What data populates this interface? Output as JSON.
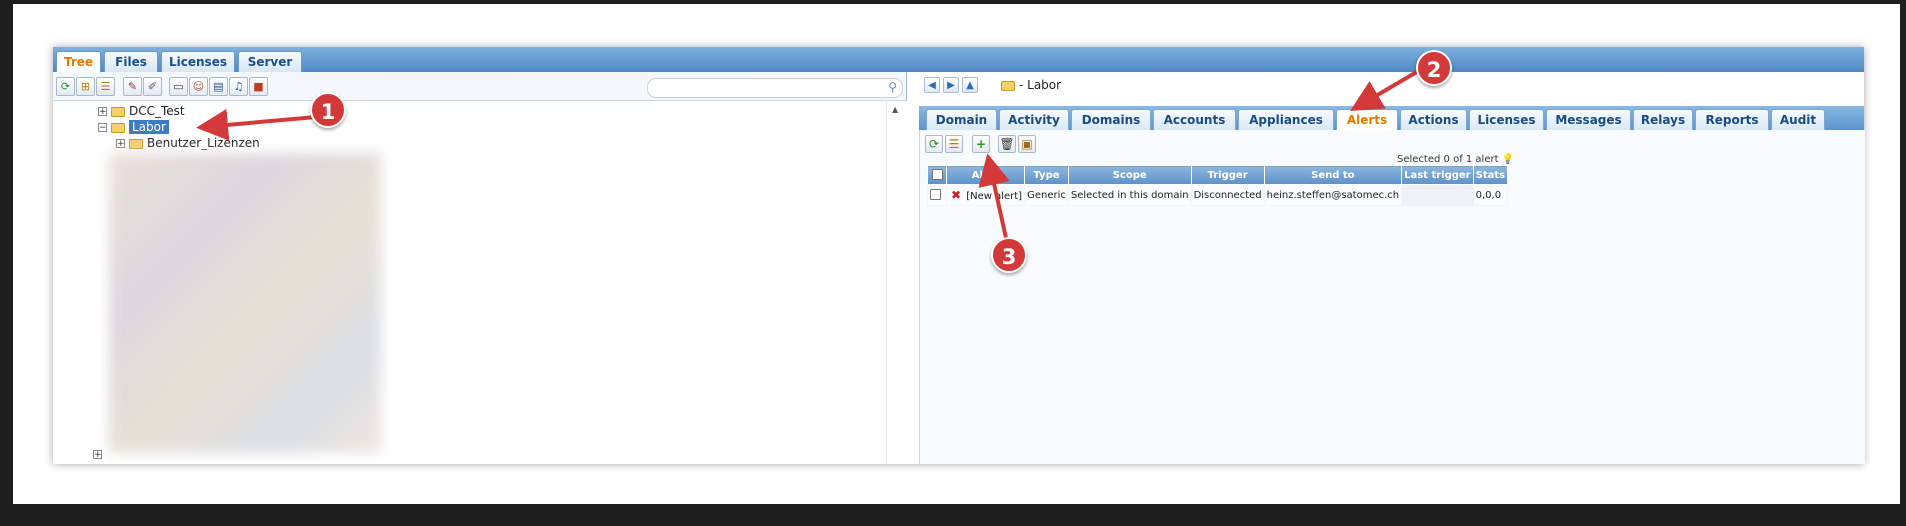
{
  "top_tabs": [
    "Tree",
    "Files",
    "Licenses",
    "Server"
  ],
  "tree": {
    "search_placeholder": "",
    "nodes": {
      "dcc_test": "DCC_Test",
      "labor": "Labor",
      "benutzer_lizenzen": "Benutzer_Lizenzen"
    }
  },
  "breadcrumb": "- Labor",
  "tabs": [
    "Domain",
    "Activity",
    "Domains",
    "Accounts",
    "Appliances",
    "Alerts",
    "Actions",
    "Licenses",
    "Messages",
    "Relays",
    "Reports",
    "Audit"
  ],
  "active_tab": "Alerts",
  "alerts": {
    "selected_text": "Selected 0 of 1 alert",
    "columns": [
      "Alert",
      "Type",
      "Scope",
      "Trigger",
      "Send to",
      "Last trigger",
      "Stats"
    ],
    "rows": [
      {
        "name": "[New alert]",
        "type": "Generic",
        "scope": "Selected in this domain",
        "trigger": "Disconnected",
        "send_to": "heinz.steffen@satomec.ch",
        "last_trigger": "",
        "stats": "0,0,0"
      }
    ]
  },
  "annotations": [
    "1",
    "2",
    "3"
  ],
  "colors": {
    "accent_orange": "#e07b00",
    "header_blue": "#5b94cb",
    "annotation_red": "#d23a3a"
  },
  "icons": [
    "refresh-icon",
    "add-folder-icon",
    "tree-icon",
    "tag-icon",
    "brush-icon",
    "hdd-icon",
    "user-icon",
    "window-icon",
    "bell-icon",
    "toolbox-icon",
    "search-icon",
    "back-icon",
    "forward-icon",
    "up-icon",
    "add-icon",
    "delete-icon",
    "export-icon",
    "bulb-icon"
  ]
}
